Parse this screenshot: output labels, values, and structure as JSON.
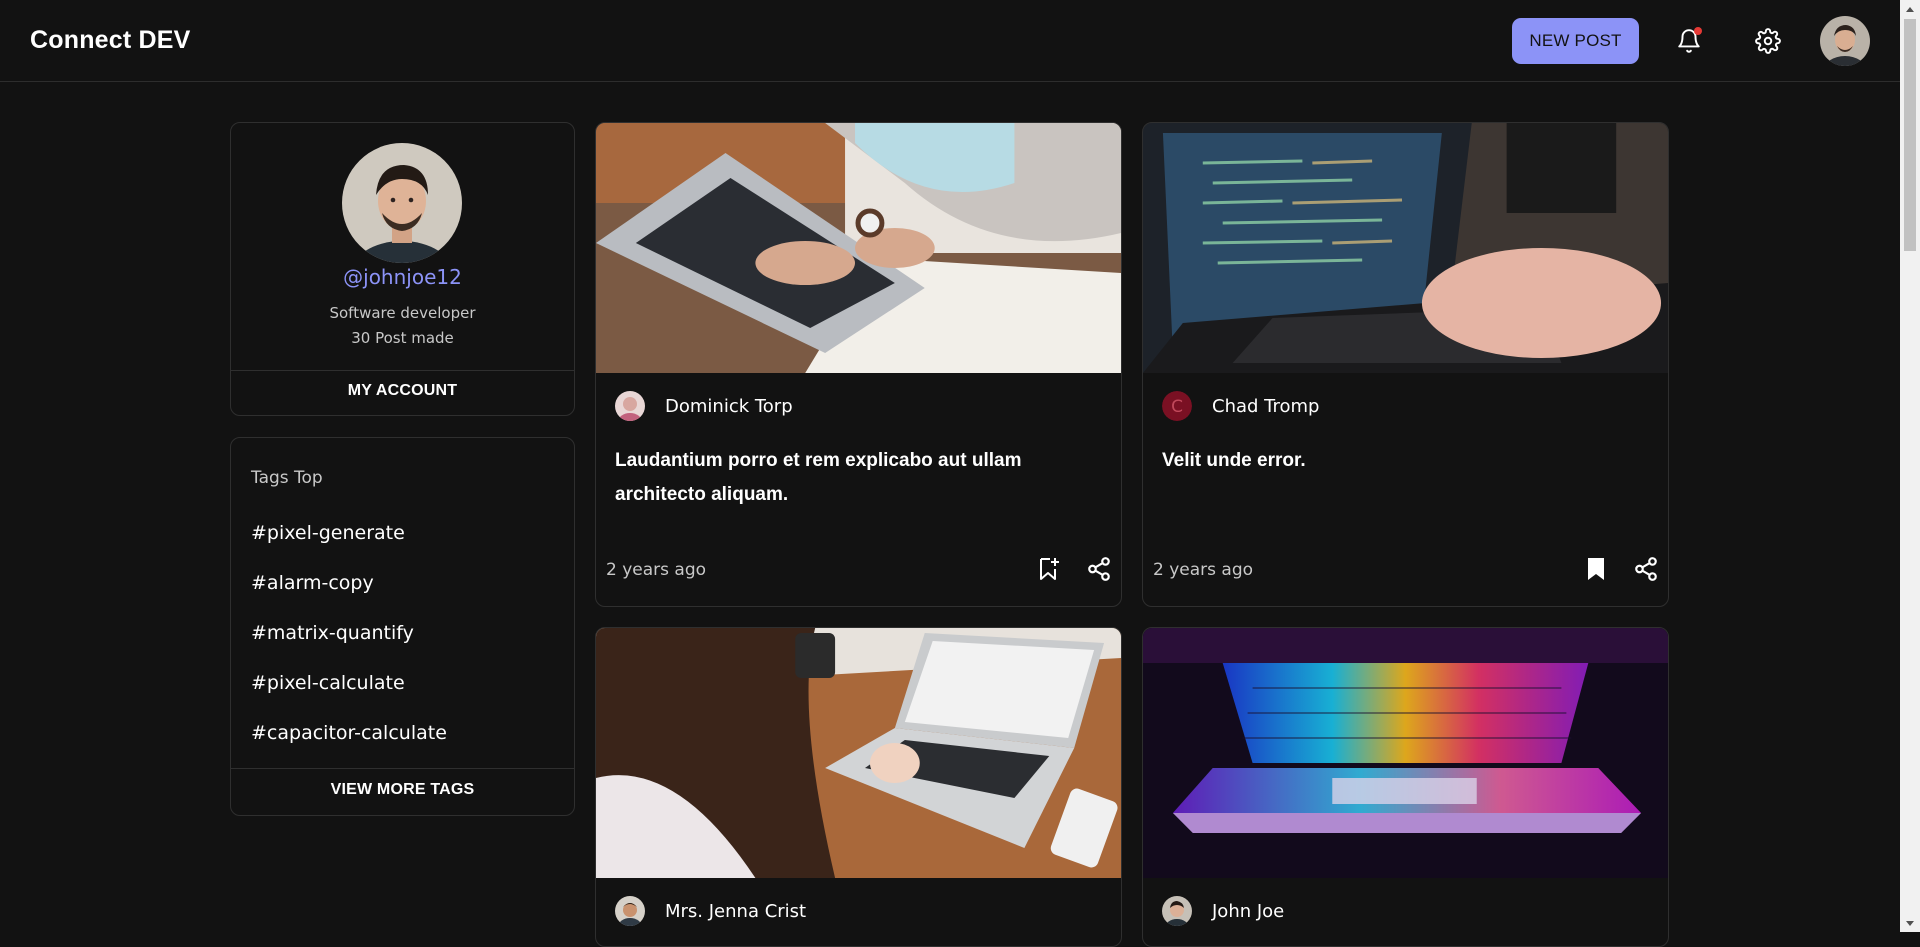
{
  "header": {
    "brand": "Connect DEV",
    "new_post_label": "NEW POST",
    "icons": [
      "bell-icon",
      "gear-icon"
    ],
    "notification_dot_color": "#e53935",
    "accent_color": "#8c93f7"
  },
  "profile": {
    "username": "@johnjoe12",
    "role": "Software developer",
    "posts_made": "30 Post made",
    "my_account_label": "MY ACCOUNT"
  },
  "tags": {
    "title": "Tags Top",
    "items": [
      "#pixel-generate",
      "#alarm-copy",
      "#matrix-quantify",
      "#pixel-calculate",
      "#capacitor-calculate"
    ],
    "view_more_label": "VIEW MORE TAGS"
  },
  "posts": [
    {
      "author": "Dominick Torp",
      "title": "Laudantium porro et rem explicabo aut ullam architecto aliquam.",
      "time": "2 years ago",
      "bookmarked": false
    },
    {
      "author": "Chad Tromp",
      "author_initial": "C",
      "title": "Velit unde error.",
      "time": "2 years ago",
      "bookmarked": true
    },
    {
      "author": "Mrs. Jenna Crist"
    },
    {
      "author": "John Joe"
    }
  ]
}
